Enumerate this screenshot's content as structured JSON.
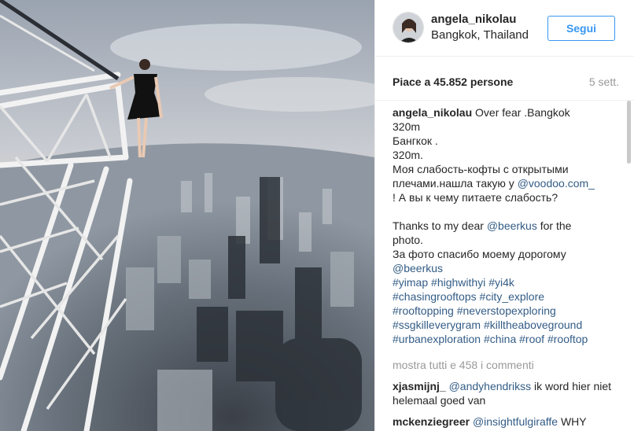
{
  "header": {
    "username": "angela_nikolau",
    "location": "Bangkok, Thailand",
    "follow_label": "Segui"
  },
  "stats": {
    "likes_text": "Piace a 45.852 persone",
    "time_ago": "5 sett."
  },
  "caption": {
    "author": "angela_nikolau",
    "lines": [
      {
        "parts": [
          {
            "t": "Over fear .Bangkok",
            "k": "text"
          }
        ]
      },
      {
        "parts": [
          {
            "t": "320m",
            "k": "text"
          }
        ]
      },
      {
        "parts": [
          {
            "t": "Бангкок .",
            "k": "text"
          }
        ]
      },
      {
        "parts": [
          {
            "t": "320m.",
            "k": "text"
          }
        ]
      },
      {
        "parts": [
          {
            "t": "Моя слабость-кофты с открытыми",
            "k": "text"
          }
        ]
      },
      {
        "parts": [
          {
            "t": "плечами.нашла такую у ",
            "k": "text"
          },
          {
            "t": "@voodoo.com_",
            "k": "mention"
          }
        ]
      },
      {
        "parts": [
          {
            "t": "! А вы к чему питаете слабость?",
            "k": "text"
          }
        ]
      },
      {
        "parts": []
      },
      {
        "parts": [
          {
            "t": "Thanks to my dear ",
            "k": "text"
          },
          {
            "t": "@beerkus",
            "k": "mention"
          },
          {
            "t": " for the",
            "k": "text"
          }
        ]
      },
      {
        "parts": [
          {
            "t": "photo.",
            "k": "text"
          }
        ]
      },
      {
        "parts": [
          {
            "t": "За фото спасибо моему дорогому",
            "k": "text"
          }
        ]
      },
      {
        "parts": [
          {
            "t": "@beerkus",
            "k": "mention"
          }
        ]
      },
      {
        "parts": [
          {
            "t": "#yimap",
            "k": "hashtag"
          },
          {
            "t": " ",
            "k": "text"
          },
          {
            "t": "#highwithyi",
            "k": "hashtag"
          },
          {
            "t": " ",
            "k": "text"
          },
          {
            "t": "#yi4k",
            "k": "hashtag"
          }
        ]
      },
      {
        "parts": [
          {
            "t": "#chasingrooftops",
            "k": "hashtag"
          },
          {
            "t": " ",
            "k": "text"
          },
          {
            "t": "#city_explore",
            "k": "hashtag"
          }
        ]
      },
      {
        "parts": [
          {
            "t": "#rooftopping",
            "k": "hashtag"
          },
          {
            "t": " ",
            "k": "text"
          },
          {
            "t": "#neverstopexploring",
            "k": "hashtag"
          }
        ]
      },
      {
        "parts": [
          {
            "t": "#ssgkilleverygram",
            "k": "hashtag"
          },
          {
            "t": " ",
            "k": "text"
          },
          {
            "t": "#killtheaboveground",
            "k": "hashtag"
          }
        ]
      },
      {
        "parts": [
          {
            "t": "#urbanexploration",
            "k": "hashtag"
          },
          {
            "t": " ",
            "k": "text"
          },
          {
            "t": "#china",
            "k": "hashtag"
          },
          {
            "t": " ",
            "k": "text"
          },
          {
            "t": "#roof",
            "k": "hashtag"
          },
          {
            "t": " ",
            "k": "text"
          },
          {
            "t": "#rooftop",
            "k": "hashtag"
          }
        ]
      }
    ]
  },
  "view_all_label": "mostra tutti e 458 i commenti",
  "comments": [
    {
      "author": "xjasmijnj_",
      "mention": "@andyhendrikss",
      "text": " ik word hier niet helemaal goed van"
    },
    {
      "author": "mckenziegreer",
      "mention": "@insightfulgiraffe",
      "text": " WHY"
    }
  ],
  "colors": {
    "accent_blue": "#3897f0",
    "link_blue": "#335c86",
    "muted_gray": "#999999"
  },
  "icons": {
    "avatar": "profile-photo"
  }
}
